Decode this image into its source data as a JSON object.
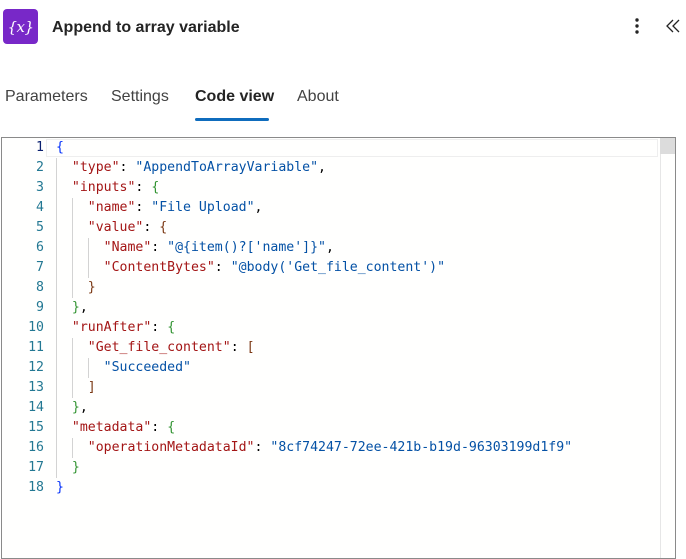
{
  "header": {
    "title": "Append to array variable",
    "icon": "variable-icon",
    "icon_text": "{x}",
    "icon_color": "#7828c8",
    "more_icon": "more-vertical-icon",
    "collapse_icon": "double-chevron-left-icon"
  },
  "tabs": [
    {
      "label": "Parameters",
      "active": false
    },
    {
      "label": "Settings",
      "active": false
    },
    {
      "label": "Code view",
      "active": true
    },
    {
      "label": "About",
      "active": false
    }
  ],
  "accent_color": "#0f6cbd",
  "editor": {
    "lines": [
      {
        "n": "1",
        "tokens": [
          [
            "b1",
            "{"
          ]
        ]
      },
      {
        "n": "2",
        "tokens": [
          [
            "p",
            "  "
          ],
          [
            "k",
            "\"type\""
          ],
          [
            "p",
            ": "
          ],
          [
            "s",
            "\"AppendToArrayVariable\""
          ],
          [
            "p",
            ","
          ]
        ]
      },
      {
        "n": "3",
        "tokens": [
          [
            "p",
            "  "
          ],
          [
            "k",
            "\"inputs\""
          ],
          [
            "p",
            ": "
          ],
          [
            "b2",
            "{"
          ]
        ]
      },
      {
        "n": "4",
        "tokens": [
          [
            "p",
            "    "
          ],
          [
            "k",
            "\"name\""
          ],
          [
            "p",
            ": "
          ],
          [
            "s",
            "\"File Upload\""
          ],
          [
            "p",
            ","
          ]
        ]
      },
      {
        "n": "5",
        "tokens": [
          [
            "p",
            "    "
          ],
          [
            "k",
            "\"value\""
          ],
          [
            "p",
            ": "
          ],
          [
            "b3",
            "{"
          ]
        ]
      },
      {
        "n": "6",
        "tokens": [
          [
            "p",
            "      "
          ],
          [
            "k",
            "\"Name\""
          ],
          [
            "p",
            ": "
          ],
          [
            "s",
            "\"@{item()?['name']}\""
          ],
          [
            "p",
            ","
          ]
        ]
      },
      {
        "n": "7",
        "tokens": [
          [
            "p",
            "      "
          ],
          [
            "k",
            "\"ContentBytes\""
          ],
          [
            "p",
            ": "
          ],
          [
            "s",
            "\"@body('Get_file_content')\""
          ]
        ]
      },
      {
        "n": "8",
        "tokens": [
          [
            "p",
            "    "
          ],
          [
            "b3",
            "}"
          ]
        ]
      },
      {
        "n": "9",
        "tokens": [
          [
            "p",
            "  "
          ],
          [
            "b2",
            "}"
          ],
          [
            "p",
            ","
          ]
        ]
      },
      {
        "n": "10",
        "tokens": [
          [
            "p",
            "  "
          ],
          [
            "k",
            "\"runAfter\""
          ],
          [
            "p",
            ": "
          ],
          [
            "b2",
            "{"
          ]
        ]
      },
      {
        "n": "11",
        "tokens": [
          [
            "p",
            "    "
          ],
          [
            "k",
            "\"Get_file_content\""
          ],
          [
            "p",
            ": "
          ],
          [
            "b3",
            "["
          ]
        ]
      },
      {
        "n": "12",
        "tokens": [
          [
            "p",
            "      "
          ],
          [
            "s",
            "\"Succeeded\""
          ]
        ]
      },
      {
        "n": "13",
        "tokens": [
          [
            "p",
            "    "
          ],
          [
            "b3",
            "]"
          ]
        ]
      },
      {
        "n": "14",
        "tokens": [
          [
            "p",
            "  "
          ],
          [
            "b2",
            "}"
          ],
          [
            "p",
            ","
          ]
        ]
      },
      {
        "n": "15",
        "tokens": [
          [
            "p",
            "  "
          ],
          [
            "k",
            "\"metadata\""
          ],
          [
            "p",
            ": "
          ],
          [
            "b2",
            "{"
          ]
        ]
      },
      {
        "n": "16",
        "tokens": [
          [
            "p",
            "    "
          ],
          [
            "k",
            "\"operationMetadataId\""
          ],
          [
            "p",
            ": "
          ],
          [
            "s",
            "\"8cf74247-72ee-421b-b19d-96303199d1f9\""
          ]
        ]
      },
      {
        "n": "17",
        "tokens": [
          [
            "p",
            "  "
          ],
          [
            "b2",
            "}"
          ]
        ]
      },
      {
        "n": "18",
        "tokens": [
          [
            "b1",
            "}"
          ]
        ]
      }
    ]
  }
}
